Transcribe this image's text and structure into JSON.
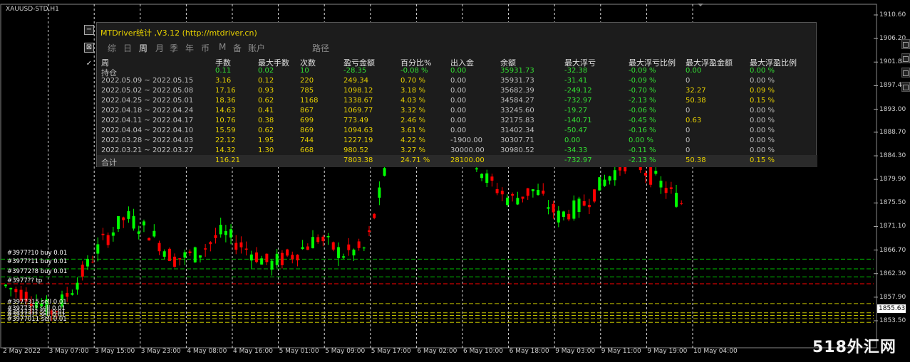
{
  "chart": {
    "symbol": "XAUUSD-STD,H1",
    "current_price": "1855.63",
    "price_ticks": [
      "1910.60",
      "1906.20",
      "1901.80",
      "1897.40",
      "1893.00",
      "1888.70",
      "1884.30",
      "1879.90",
      "1875.50",
      "1871.10",
      "1866.70",
      "1862.30",
      "1857.90",
      "1853.50"
    ],
    "time_ticks": [
      "2 May 2022",
      "3 May 07:00",
      "3 May 15:00",
      "3 May 23:00",
      "4 May 08:00",
      "4 May 16:00",
      "5 May 01:00",
      "5 May 09:00",
      "5 May 17:00",
      "6 May 02:00",
      "6 May 10:00",
      "6 May 18:00",
      "9 May 03:00",
      "9 May 11:00",
      "9 May 19:00",
      "10 May 04:00"
    ],
    "colors": {
      "bull": "#00ff00",
      "bear": "#ff0000",
      "grid": "#ffffff",
      "buy_line": "#00c000",
      "sell_line": "#ff3030",
      "tp_line": "#ff0000"
    },
    "order_labels": [
      {
        "text": "#3977?10 buy 0.01",
        "type": "buy"
      },
      {
        "text": "#3977?11 buy 0.01",
        "type": "buy"
      },
      {
        "text": "#39772?8 buy 0.01",
        "type": "buy"
      },
      {
        "text": "#3977?? tp",
        "type": "tp"
      },
      {
        "text": "#3977315 sell 0.01",
        "type": "sell"
      },
      {
        "text": "#39773?? sell 0.01",
        "type": "sell"
      },
      {
        "text": "#39773?? sell 0.01",
        "type": "sell"
      },
      {
        "text": "#39773?? sell 0.01",
        "type": "sell"
      },
      {
        "text": "#3977011 sell 0.01",
        "type": "sell"
      }
    ]
  },
  "panel": {
    "title": "MTDriver统计 ,V3.12 (http://mtdriver.cn)",
    "tabs": [
      "综",
      "日",
      "周",
      "月",
      "季",
      "年",
      "币",
      "M",
      "备",
      "账户",
      "路径"
    ],
    "active_tab": "周",
    "columns": [
      "周",
      "手数",
      "最大手数",
      "次数",
      "盈亏金额",
      "百分比%",
      "出入金",
      "余额",
      "最大浮亏",
      "最大浮亏比例",
      "最大浮盈金额",
      "最大浮盈比例"
    ],
    "rows": [
      [
        "持仓",
        "0.11",
        "0.02",
        "10",
        "-28.35",
        "-0.08 %",
        "0.00",
        "35931.73",
        "-32.38",
        "-0.09 %",
        "0.00",
        "0.00 %"
      ],
      [
        "2022.05.09 ~ 2022.05.15",
        "3.16",
        "0.12",
        "220",
        "249.34",
        "0.70 %",
        "0.00",
        "35931.73",
        "-31.41",
        "-0.09 %",
        "0",
        "0.00 %"
      ],
      [
        "2022.05.02 ~ 2022.05.08",
        "17.16",
        "0.93",
        "785",
        "1098.12",
        "3.18 %",
        "0.00",
        "35682.39",
        "-249.12",
        "-0.70 %",
        "32.27",
        "0.09 %"
      ],
      [
        "2022.04.25 ~ 2022.05.01",
        "18.36",
        "0.62",
        "1168",
        "1338.67",
        "4.03 %",
        "0.00",
        "34584.27",
        "-732.97",
        "-2.13 %",
        "50.38",
        "0.15 %"
      ],
      [
        "2022.04.18 ~ 2022.04.24",
        "14.63",
        "0.41",
        "867",
        "1069.77",
        "3.32 %",
        "0.00",
        "33245.60",
        "-19.27",
        "-0.06 %",
        "0",
        "0.00 %"
      ],
      [
        "2022.04.11 ~ 2022.04.17",
        "10.76",
        "0.38",
        "699",
        "773.49",
        "2.46 %",
        "0.00",
        "32175.83",
        "-140.71",
        "-0.45 %",
        "0.63",
        "0.00 %"
      ],
      [
        "2022.04.04 ~ 2022.04.10",
        "15.59",
        "0.62",
        "869",
        "1094.63",
        "3.61 %",
        "0.00",
        "31402.34",
        "-50.47",
        "-0.16 %",
        "0",
        "0.00 %"
      ],
      [
        "2022.03.28 ~ 2022.04.03",
        "22.12",
        "1.95",
        "744",
        "1227.19",
        "4.22 %",
        "-1900.00",
        "30307.71",
        "0.00",
        "0.00 %",
        "0",
        "0.00 %"
      ],
      [
        "2022.03.21 ~ 2022.03.27",
        "14.32",
        "1.30",
        "668",
        "980.52",
        "3.27 %",
        "30000.00",
        "30980.52",
        "-34.33",
        "-0.11 %",
        "0",
        "0.00 %"
      ]
    ],
    "summary": [
      "合计",
      "116.21",
      "",
      "",
      "7803.38",
      "24.71 %",
      "28100.00",
      "",
      "-732.97",
      "-2.13 %",
      "50.38",
      "0.15 %"
    ]
  },
  "watermark": "518外汇网"
}
